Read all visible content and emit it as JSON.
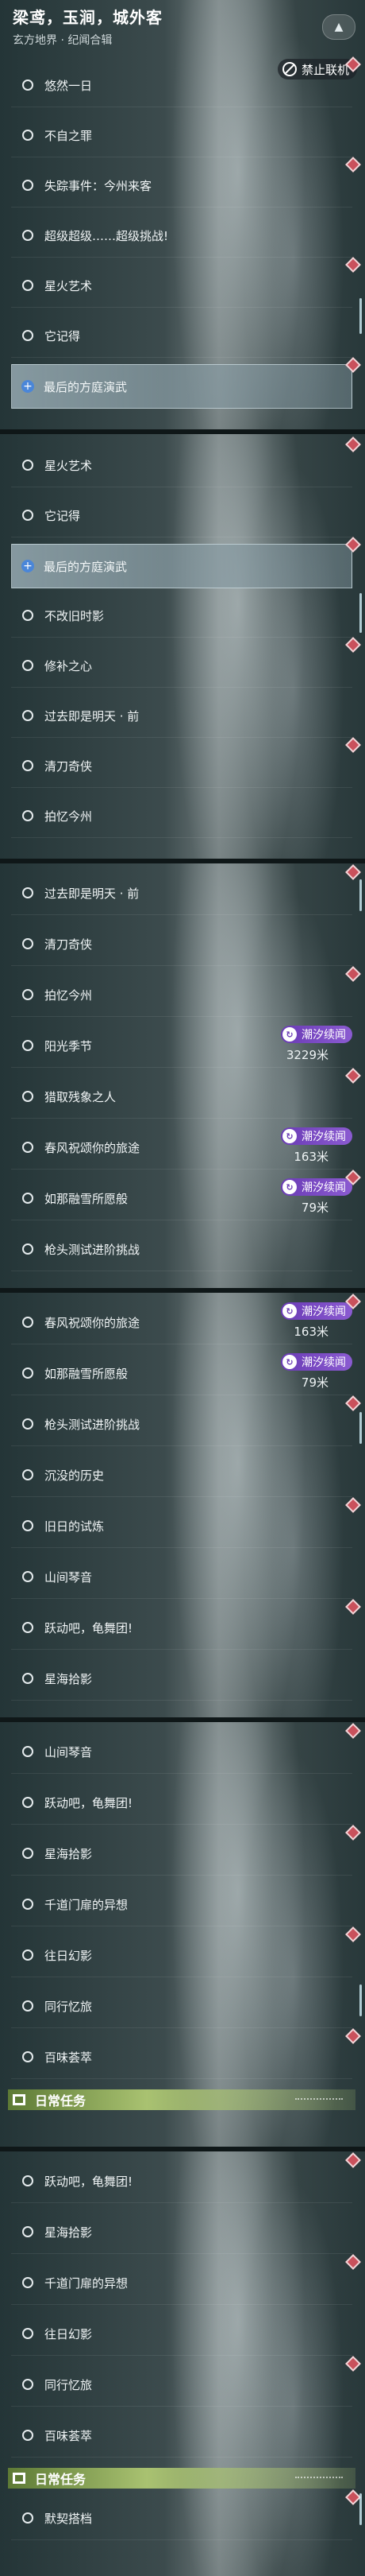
{
  "header": {
    "title": "梁鸢，玉涧，城外客",
    "subtitle": "玄方地界 · 纪闻合辑",
    "collapse_icon": "chevron-up-icon",
    "forbid_label": "禁止联机"
  },
  "segments": [
    {
      "rows": [
        {
          "label": "悠然一日"
        },
        {
          "label": "不自之罪"
        },
        {
          "label": "失踪事件：今州来客"
        },
        {
          "label": "超级超级……超级挑战!"
        },
        {
          "label": "星火艺术"
        },
        {
          "label": "它记得"
        },
        {
          "label": "最后的方庭演武",
          "active": true
        }
      ]
    },
    {
      "rows": [
        {
          "label": "星火艺术"
        },
        {
          "label": "它记得"
        },
        {
          "label": "最后的方庭演武",
          "active": true
        },
        {
          "label": "不改旧时影"
        },
        {
          "label": "修补之心"
        },
        {
          "label": "过去即是明天 · 前"
        },
        {
          "label": "清刀奇侠"
        },
        {
          "label": "拍忆今州"
        }
      ]
    },
    {
      "rows": [
        {
          "label": "过去即是明天 · 前"
        },
        {
          "label": "清刀奇侠"
        },
        {
          "label": "拍忆今州"
        },
        {
          "label": "阳光季节",
          "tide": "潮汐续闻",
          "distance": "3229米"
        },
        {
          "label": "猎取残象之人"
        },
        {
          "label": "春风祝颂你的旅途",
          "tide": "潮汐续闻",
          "distance": "163米"
        },
        {
          "label": "如那融雪所愿般",
          "tide": "潮汐续闻",
          "distance": "79米"
        },
        {
          "label": "枪头测试进阶挑战"
        }
      ]
    },
    {
      "rows": [
        {
          "label": "春风祝颂你的旅途",
          "tide": "潮汐续闻",
          "distance": "163米"
        },
        {
          "label": "如那融雪所愿般",
          "tide": "潮汐续闻",
          "distance": "79米"
        },
        {
          "label": "枪头测试进阶挑战"
        },
        {
          "label": "沉没的历史"
        },
        {
          "label": "旧日的试炼"
        },
        {
          "label": "山间琴音"
        },
        {
          "label": "跃动吧，龟舞团!"
        },
        {
          "label": "星海拾影"
        }
      ]
    },
    {
      "rows": [
        {
          "label": "山间琴音"
        },
        {
          "label": "跃动吧，龟舞团!"
        },
        {
          "label": "星海拾影"
        },
        {
          "label": "千道门扉的异想"
        },
        {
          "label": "往日幻影"
        },
        {
          "label": "同行忆旅"
        },
        {
          "label": "百味荟萃"
        }
      ],
      "daily_title": "日常任务"
    },
    {
      "rows": [
        {
          "label": "跃动吧，龟舞团!"
        },
        {
          "label": "星海拾影"
        },
        {
          "label": "千道门扉的异想"
        },
        {
          "label": "往日幻影"
        },
        {
          "label": "同行忆旅"
        },
        {
          "label": "百味荟萃"
        }
      ],
      "daily_title": "日常任务",
      "after_daily": [
        {
          "label": "默契搭档"
        }
      ]
    }
  ],
  "colors": {
    "marker": "#c9515c",
    "tide_badge": "#6a3bb5",
    "active_plus": "#4a86d8",
    "daily_bar": "#a9c271"
  }
}
